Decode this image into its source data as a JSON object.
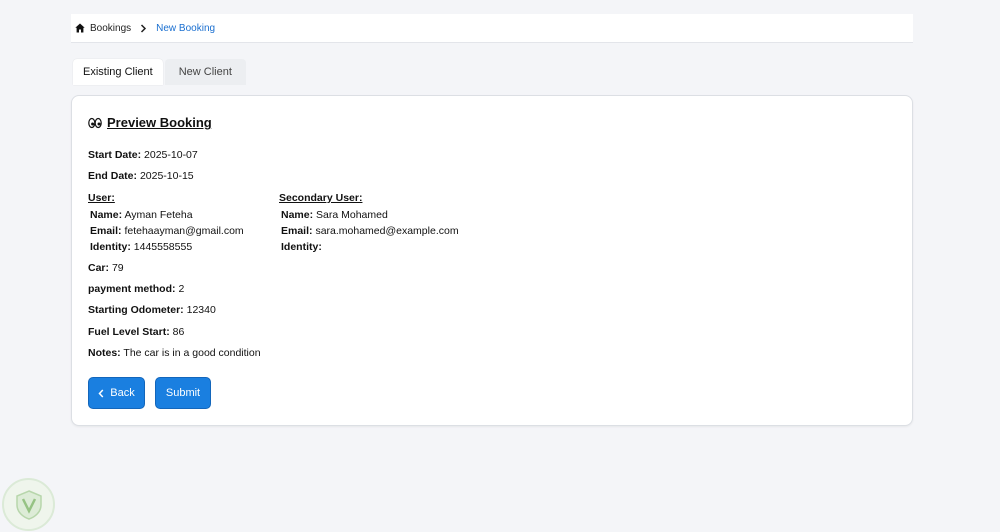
{
  "breadcrumb": {
    "home_label": "Bookings",
    "current_label": "New Booking"
  },
  "tabs": [
    {
      "label": "Existing Client",
      "active": true
    },
    {
      "label": "New Client",
      "active": false
    }
  ],
  "preview": {
    "title": "Preview Booking",
    "start_date": {
      "label": "Start Date:",
      "value": "2025-10-07"
    },
    "end_date": {
      "label": "End Date:",
      "value": "2025-10-15"
    },
    "user": {
      "heading": "User:",
      "name_label": "Name:",
      "name": "Ayman Feteha",
      "email_label": "Email:",
      "email": "fetehaayman@gmail.com",
      "identity_label": "Identity:",
      "identity": "1445558555"
    },
    "secondary_user": {
      "heading": "Secondary User:",
      "name_label": "Name:",
      "name": "Sara Mohamed",
      "email_label": "Email:",
      "email": "sara.mohamed@example.com",
      "identity_label": "Identity:",
      "identity": ""
    },
    "car": {
      "label": "Car:",
      "value": "79"
    },
    "payment_method": {
      "label": "payment method:",
      "value": "2"
    },
    "starting_odometer": {
      "label": "Starting Odometer:",
      "value": "12340"
    },
    "fuel_level_start": {
      "label": "Fuel Level Start:",
      "value": "86"
    },
    "notes": {
      "label": "Notes:",
      "value": "The car is in a good condition"
    }
  },
  "buttons": {
    "back_label": "Back",
    "submit_label": "Submit"
  },
  "colors": {
    "accent": "#1a7fe0",
    "link": "#1a6fd0",
    "background": "#f4f5f8"
  }
}
